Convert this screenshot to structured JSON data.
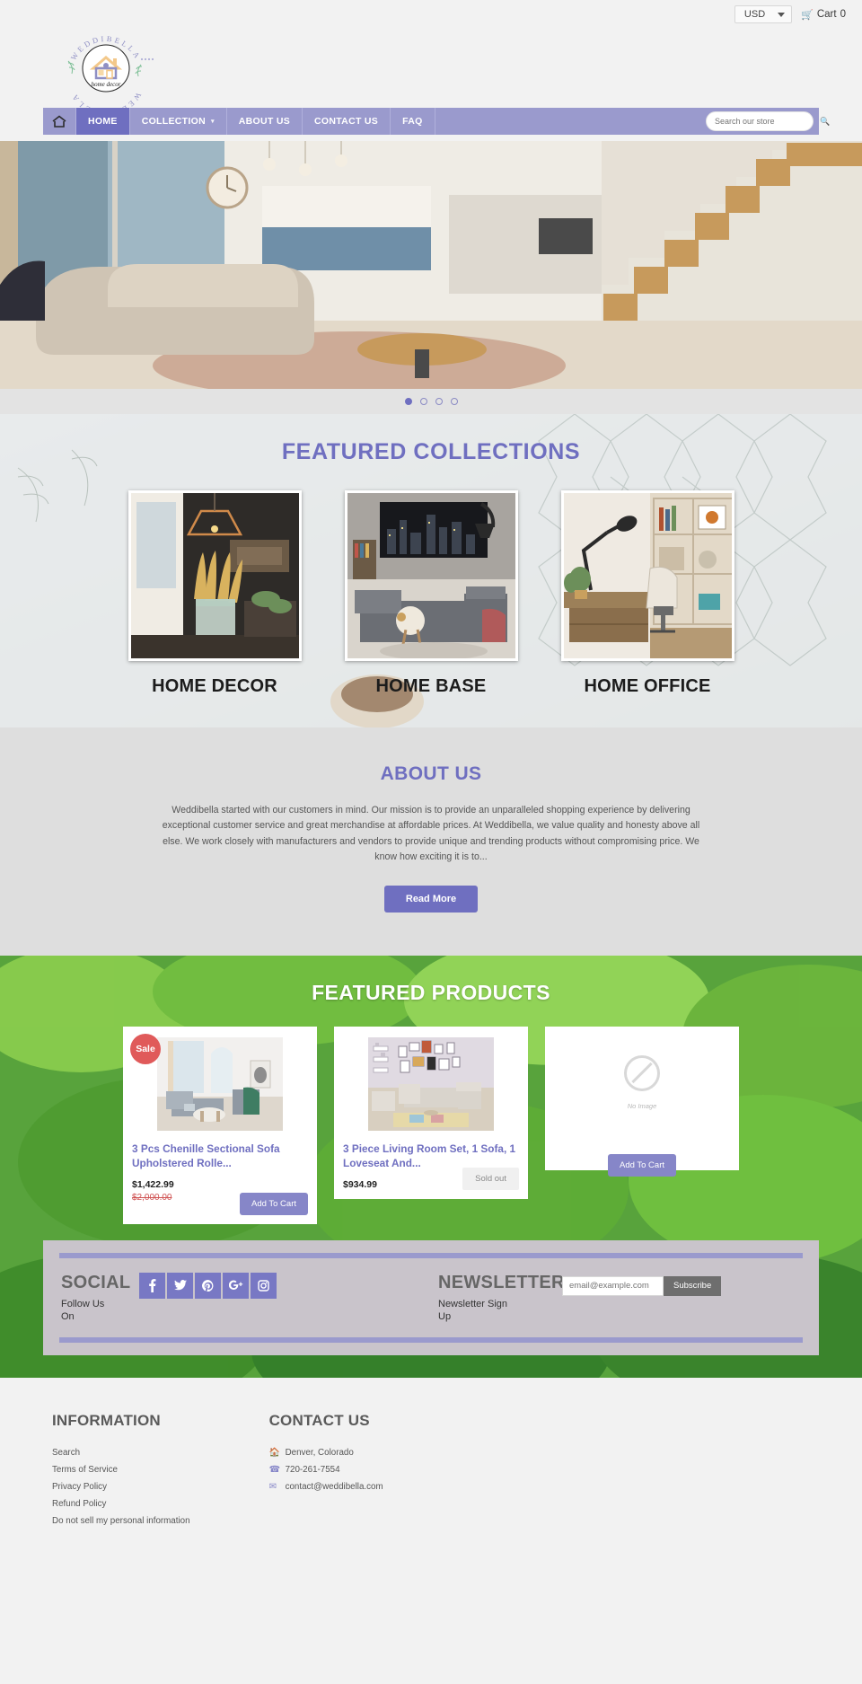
{
  "topbar": {
    "currency": "USD",
    "cart_label": "Cart",
    "cart_count": "0",
    "cart_icon": "cart-icon",
    "caret_icon": "chevron-down-icon"
  },
  "logo": {
    "outer_text": "WEDDIBELLA",
    "inner_text": "home decor",
    "alt": "weddibella-home-decor-logo"
  },
  "nav": {
    "home_icon": "home-icon",
    "items": [
      {
        "label": "HOME",
        "active": true
      },
      {
        "label": "COLLECTION",
        "caret": "▾",
        "active": false
      },
      {
        "label": "ABOUT US",
        "active": false
      },
      {
        "label": "CONTACT US",
        "active": false
      },
      {
        "label": "FAQ",
        "active": false
      }
    ],
    "search_placeholder": "Search our store",
    "search_value": "",
    "search_icon": "search-icon"
  },
  "hero": {
    "alt": "modern-living-room-hero-image",
    "dots": [
      {
        "active": true
      },
      {
        "active": false
      },
      {
        "active": false
      },
      {
        "active": false
      }
    ]
  },
  "collections": {
    "title": "FEATURED COLLECTIONS",
    "items": [
      {
        "label": "HOME DECOR",
        "alt": "home-decor-collection-image"
      },
      {
        "label": "HOME BASE",
        "alt": "home-base-collection-image"
      },
      {
        "label": "HOME OFFICE",
        "alt": "home-office-collection-image"
      }
    ]
  },
  "about": {
    "title": "ABOUT US",
    "body": "Weddibella started with our customers in mind. Our mission is to provide an unparalleled shopping experience by delivering exceptional customer service and great merchandise at affordable prices. At Weddibella, we value quality and honesty above all else. We work closely with manufacturers and vendors to provide unique and trending products without compromising price. We know how exciting it is to...",
    "button": "Read More"
  },
  "products": {
    "title": "FEATURED PRODUCTS",
    "items": [
      {
        "badge": "Sale",
        "title": "3 Pcs Chenille Sectional Sofa Upholstered Rolle...",
        "price": "$1,422.99",
        "compare_at": "$2,000.00",
        "button": "Add To Cart",
        "sold_out": false,
        "has_image": true,
        "alt": "sectional-sofa-product-image"
      },
      {
        "badge": "",
        "title": "3 Piece Living Room Set, 1 Sofa, 1 Loveseat And...",
        "price": "$934.99",
        "compare_at": "",
        "button": "Sold out",
        "sold_out": true,
        "has_image": true,
        "alt": "living-room-set-product-image"
      },
      {
        "badge": "",
        "title": "",
        "price": "",
        "compare_at": "",
        "button": "Add To Cart",
        "sold_out": false,
        "has_image": false,
        "no_image_text": "No Image"
      }
    ]
  },
  "social": {
    "heading": "SOCIAL",
    "subtext": "Follow Us On",
    "icons": [
      {
        "name": "facebook-icon",
        "glyph": "f"
      },
      {
        "name": "twitter-icon",
        "glyph": "t"
      },
      {
        "name": "pinterest-icon",
        "glyph": "p"
      },
      {
        "name": "google-plus-icon",
        "glyph": "g+"
      },
      {
        "name": "instagram-icon",
        "glyph": "ig"
      }
    ]
  },
  "newsletter": {
    "heading": "NEWSLETTER",
    "subtext": "Newsletter Sign Up",
    "placeholder": "email@example.com",
    "value": "",
    "button": "Subscribe"
  },
  "footer": {
    "information": {
      "title": "INFORMATION",
      "links": [
        "Search",
        "Terms of Service",
        "Privacy Policy",
        "Refund Policy",
        "Do not sell my personal information"
      ]
    },
    "contact": {
      "title": "CONTACT US",
      "address": "Denver, Colorado",
      "phone": "720-261-7554",
      "email": "contact@weddibella.com",
      "address_icon": "location-icon",
      "phone_icon": "phone-icon",
      "email_icon": "envelope-icon"
    }
  },
  "colors": {
    "accent": "#6f6fc0",
    "nav_bg": "#9a9acd",
    "sale_badge": "#e05a5a",
    "compare_price": "#d05252"
  }
}
